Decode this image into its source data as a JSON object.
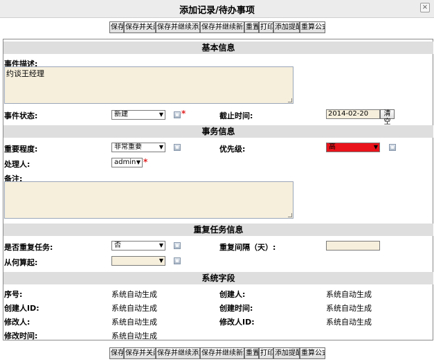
{
  "window": {
    "title": "添加记录/待办事项",
    "close_glyph": "×"
  },
  "toolbar": {
    "buttons": [
      "保存",
      "保存并关闭",
      "保存并继续添加",
      "保存并继续新增",
      "重置",
      "打印",
      "添加提醒",
      "重算公式"
    ]
  },
  "sections": {
    "basic": "基本信息",
    "business": "事务信息",
    "repeat": "重复任务信息",
    "system": "系统字段"
  },
  "basic": {
    "description_label": "事件描述:",
    "description_value": "约谈王经理",
    "status_label": "事件状态:",
    "status_value": "新建",
    "deadline_label": "截止时间:",
    "deadline_value": "2014-02-20",
    "clear_label": "清空"
  },
  "business": {
    "importance_label": "重要程度:",
    "importance_value": "非常重要",
    "priority_label": "优先级:",
    "priority_value": "高",
    "handler_label": "处理人:",
    "handler_value": "admin",
    "remark_label": "备注:",
    "remark_value": ""
  },
  "repeat": {
    "is_repeat_label": "是否重复任务:",
    "is_repeat_value": "否",
    "interval_label": "重复间隔（天）:",
    "interval_value": "",
    "start_label": "从何算起:",
    "start_value": ""
  },
  "system": {
    "id_label": "序号:",
    "id_value": "系统自动生成",
    "creator_label": "创建人:",
    "creator_value": "系统自动生成",
    "creator_id_label": "创建人ID:",
    "creator_id_value": "系统自动生成",
    "create_time_label": "创建时间:",
    "create_time_value": "系统自动生成",
    "modifier_label": "修改人:",
    "modifier_value": "系统自动生成",
    "modifier_id_label": "修改人ID:",
    "modifier_id_value": "系统自动生成",
    "modify_time_label": "修改时间:",
    "modify_time_value": "系统自动生成"
  },
  "colors": {
    "priority_high": "#e8131b",
    "input_bg": "#f6efdc",
    "section_bg": "#dedede"
  },
  "required_mark": "*",
  "dropdown_arrow": "▼"
}
